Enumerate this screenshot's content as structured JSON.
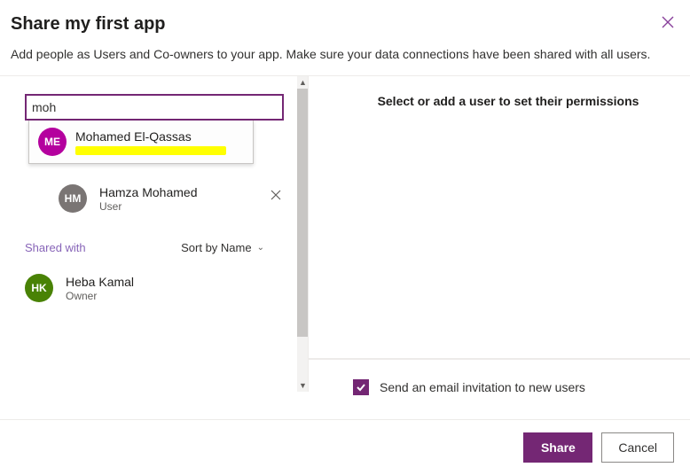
{
  "header": {
    "title": "Share my first app",
    "subtitle": "Add people as Users and Co-owners to your app. Make sure your data connections have been shared with all users."
  },
  "search": {
    "value": "moh"
  },
  "suggestion": {
    "initials": "ME",
    "name": "Mohamed El-Qassas"
  },
  "pending_user": {
    "initials": "HM",
    "name": "Hamza Mohamed",
    "role": "User"
  },
  "shared": {
    "label": "Shared with",
    "sort_label": "Sort by Name"
  },
  "owner": {
    "initials": "HK",
    "name": "Heba Kamal",
    "role": "Owner"
  },
  "right": {
    "message": "Select or add a user to set their permissions"
  },
  "email_invite": {
    "label": "Send an email invitation to new users",
    "checked": true
  },
  "buttons": {
    "share": "Share",
    "cancel": "Cancel"
  }
}
